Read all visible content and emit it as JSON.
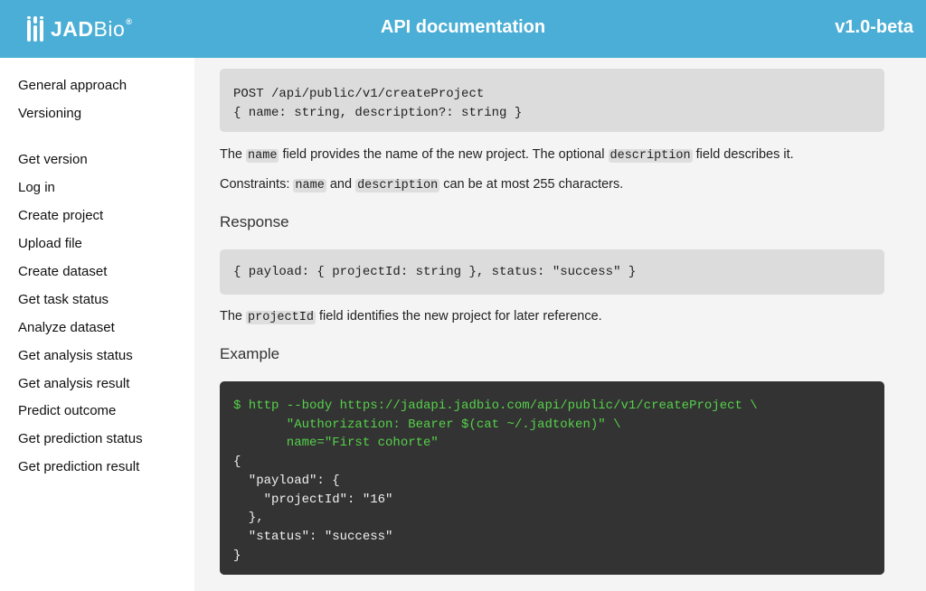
{
  "header": {
    "logo_text_bold": "JAD",
    "logo_text_light": "Bio",
    "logo_reg": "®",
    "title": "API documentation",
    "version": "v1.0-beta"
  },
  "sidebar": {
    "items": [
      {
        "label": "General approach"
      },
      {
        "label": "Versioning"
      },
      {
        "label": "Get version"
      },
      {
        "label": "Log in"
      },
      {
        "label": "Create project"
      },
      {
        "label": "Upload file"
      },
      {
        "label": "Create dataset"
      },
      {
        "label": "Get task status"
      },
      {
        "label": "Analyze dataset"
      },
      {
        "label": "Get analysis status"
      },
      {
        "label": "Get analysis result"
      },
      {
        "label": "Predict outcome"
      },
      {
        "label": "Get prediction status"
      },
      {
        "label": "Get prediction result"
      }
    ]
  },
  "main": {
    "request_code": {
      "line1": "POST /api/public/v1/createProject",
      "line2": "{ name: string, description?: string }"
    },
    "para1": {
      "t1": "The ",
      "c1": "name",
      "t2": " field provides the name of the new project. The optional ",
      "c2": "description",
      "t3": " field describes it."
    },
    "para2": {
      "t1": "Constraints: ",
      "c1": "name",
      "t2": " and ",
      "c2": "description",
      "t3": " can be at most 255 characters."
    },
    "response_heading": "Response",
    "response_code": "{ payload: { projectId: string }, status: \"success\" }",
    "para3": {
      "t1": "The ",
      "c1": "projectId",
      "t2": " field identifies the new project for later reference."
    },
    "example_heading": "Example",
    "example_lines": [
      "$ http --body https://jadapi.jadbio.com/api/public/v1/createProject \\",
      "       \"Authorization: Bearer $(cat ~/.jadtoken)\" \\",
      "       name=\"First cohorte\"",
      "{",
      "  \"payload\": {",
      "    \"projectId\": \"16\"",
      "  },",
      "  \"status\": \"success\"",
      "}"
    ]
  }
}
